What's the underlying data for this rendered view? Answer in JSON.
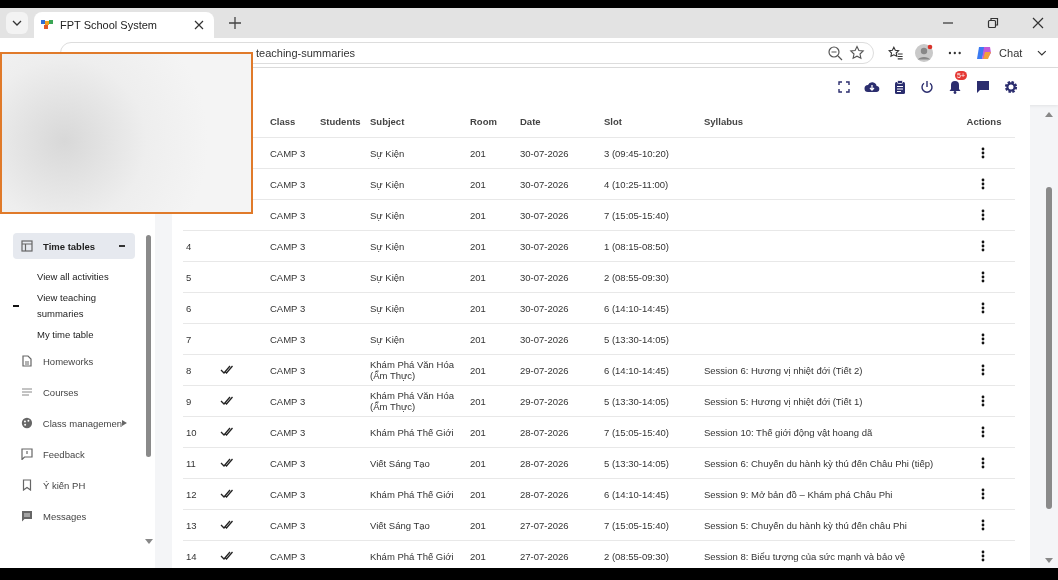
{
  "browser": {
    "tab_title": "FPT School System",
    "url": "teaching-summaries",
    "chat_label": "Chat"
  },
  "header": {
    "notification_badge": "5+"
  },
  "sidebar": {
    "items": [
      {
        "label": "Time tables",
        "selected": true,
        "expanded": true,
        "children": [
          {
            "label": "View all activities",
            "selected": false
          },
          {
            "label": "View teaching summaries",
            "selected": true
          },
          {
            "label": "My time table",
            "selected": false
          }
        ]
      },
      {
        "label": "Homeworks",
        "selected": false
      },
      {
        "label": "Courses",
        "selected": false
      },
      {
        "label": "Class managemen",
        "selected": false
      },
      {
        "label": "Feedback",
        "selected": false
      },
      {
        "label": "Ý kiến PH",
        "selected": false
      },
      {
        "label": "Messages",
        "selected": false
      }
    ]
  },
  "table": {
    "columns": [
      "Class",
      "Students",
      "Subject",
      "Room",
      "Date",
      "Slot",
      "Syllabus",
      "Actions"
    ],
    "rows": [
      {
        "class": "CAMP 3",
        "subject": "Sự Kiện",
        "room": "201",
        "date": "30-07-2026",
        "slot": "3 (09:45-10:20)"
      },
      {
        "class": "CAMP 3",
        "subject": "Sự Kiện",
        "room": "201",
        "date": "30-07-2026",
        "slot": "4 (10:25-11:00)"
      },
      {
        "class": "CAMP 3",
        "subject": "Sự Kiện",
        "room": "201",
        "date": "30-07-2026",
        "slot": "7 (15:05-15:40)"
      },
      {
        "no": "4",
        "checked": false,
        "class": "CAMP 3",
        "subject": "Sự Kiện",
        "room": "201",
        "date": "30-07-2026",
        "slot": "1 (08:15-08:50)"
      },
      {
        "no": "5",
        "checked": false,
        "class": "CAMP 3",
        "subject": "Sự Kiện",
        "room": "201",
        "date": "30-07-2026",
        "slot": "2 (08:55-09:30)"
      },
      {
        "no": "6",
        "checked": false,
        "class": "CAMP 3",
        "subject": "Sự Kiện",
        "room": "201",
        "date": "30-07-2026",
        "slot": "6 (14:10-14:45)"
      },
      {
        "no": "7",
        "checked": false,
        "class": "CAMP 3",
        "subject": "Sự Kiện",
        "room": "201",
        "date": "30-07-2026",
        "slot": "5 (13:30-14:05)"
      },
      {
        "no": "8",
        "checked": true,
        "class": "CAMP 3",
        "subject": "Khám Phá Văn Hóa (Ẩm Thực)",
        "room": "201",
        "date": "29-07-2026",
        "slot": "6 (14:10-14:45)",
        "syllabus": "Session 6: Hương vị nhiệt đới (Tiết 2)"
      },
      {
        "no": "9",
        "checked": true,
        "class": "CAMP 3",
        "subject": "Khám Phá Văn Hóa (Ẩm Thực)",
        "room": "201",
        "date": "29-07-2026",
        "slot": "5 (13:30-14:05)",
        "syllabus": "Session 5: Hương vị nhiệt đới (Tiết 1)"
      },
      {
        "no": "10",
        "checked": true,
        "class": "CAMP 3",
        "subject": "Khám Phá Thế Giới",
        "room": "201",
        "date": "28-07-2026",
        "slot": "7 (15:05-15:40)",
        "syllabus": "Session 10: Thế giới động vật hoang dã"
      },
      {
        "no": "11",
        "checked": true,
        "class": "CAMP 3",
        "subject": "Viết Sáng Tạo",
        "room": "201",
        "date": "28-07-2026",
        "slot": "5 (13:30-14:05)",
        "syllabus": "Session 6: Chuyến du hành kỳ thú đến Châu Phi (tiếp)"
      },
      {
        "no": "12",
        "checked": true,
        "class": "CAMP 3",
        "subject": "Khám Phá Thế Giới",
        "room": "201",
        "date": "28-07-2026",
        "slot": "6 (14:10-14:45)",
        "syllabus": "Session 9: Mở bản đồ – Khám phá Châu Phi"
      },
      {
        "no": "13",
        "checked": true,
        "class": "CAMP 3",
        "subject": "Viết Sáng Tạo",
        "room": "201",
        "date": "27-07-2026",
        "slot": "7 (15:05-15:40)",
        "syllabus": "Session 5: Chuyến du hành kỳ thú đến châu Phi"
      },
      {
        "no": "14",
        "checked": true,
        "class": "CAMP 3",
        "subject": "Khám Phá Thế Giới",
        "room": "201",
        "date": "27-07-2026",
        "slot": "2 (08:55-09:30)",
        "syllabus": "Session 8: Biểu tượng của sức mạnh và bảo vệ"
      }
    ]
  }
}
